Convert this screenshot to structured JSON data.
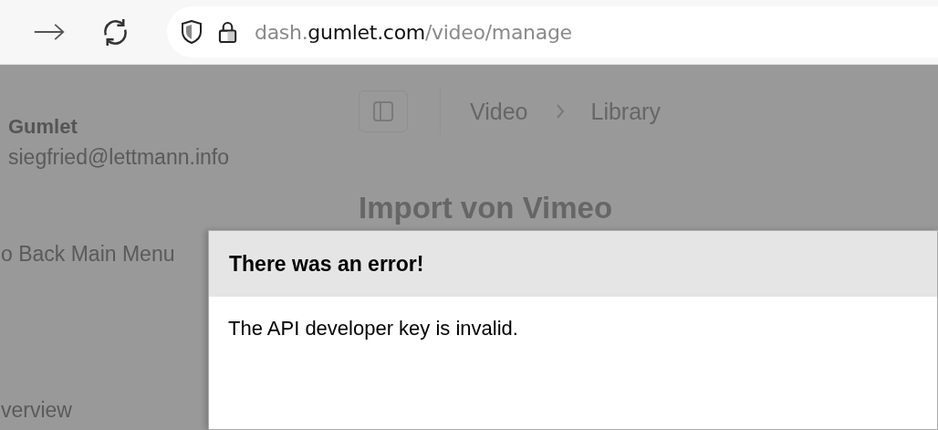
{
  "browser": {
    "url": {
      "subdomain": "dash.",
      "domain": "gumlet.com",
      "path": "/video/manage"
    }
  },
  "sidebar": {
    "account_name": "Gumlet",
    "account_email": "siegfried@lettmann.info",
    "items": [
      {
        "label": "o Back Main Menu"
      },
      {
        "label": "verview"
      }
    ]
  },
  "header": {
    "breadcrumbs": [
      "Video",
      "Library"
    ]
  },
  "page": {
    "heading": "Import von Vimeo"
  },
  "dialog": {
    "title": "There was an error!",
    "message": "The API developer key is invalid."
  }
}
